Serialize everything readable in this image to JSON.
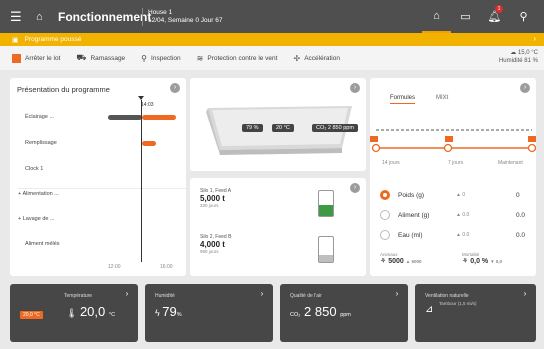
{
  "topbar": {
    "title": "Fonctionnement",
    "house_name": "House 1",
    "house_info": "12/04, Semaine 0 Jour 67",
    "alarm_count": "1"
  },
  "alert": {
    "text": "Programme poussé"
  },
  "actions": {
    "stop": "Arrêter le lot",
    "cleaning": "Ramassage",
    "inspection": "Inspection",
    "wind": "Protection contre le vent",
    "accel": "Accélération"
  },
  "weather": {
    "temp": "15,0 °C",
    "humidity": "Humidité 81 %"
  },
  "program": {
    "title": "Présentation du programme",
    "marker": "14:03",
    "rows": [
      "Éclairage ...",
      "Remplissage",
      "Clock 1",
      "Alimentation ...",
      "Lavage de ...",
      "Aliment mélés"
    ],
    "axis_start": "12:00",
    "axis_end": "16:00"
  },
  "house_view": {
    "badges": [
      "79 %",
      "20 °C",
      "CO₂ 2 850 ppm"
    ]
  },
  "silos": [
    {
      "name": "Silo 1, Feed A",
      "value": "5,000 t",
      "sub": "330 jours",
      "fill": 0.45
    },
    {
      "name": "Silo 2, Feed B",
      "value": "4,000 t",
      "sub": "990 jours",
      "fill": 0.3
    }
  ],
  "feeding": {
    "tabs": [
      "Formules",
      "MIXt"
    ],
    "steps": [
      "14 jours",
      "7 jours",
      "Maintenant"
    ],
    "rows": [
      {
        "label": "Poids (g)",
        "delta": "▲ 0",
        "value": "0",
        "selected": true
      },
      {
        "label": "Aliment (g)",
        "delta": "▲ 0.0",
        "value": "0.0",
        "selected": false
      },
      {
        "label": "Eau (ml)",
        "delta": "▲ 0.0",
        "value": "0.0",
        "selected": false
      }
    ],
    "bottom_left_label": "Animaux",
    "bottom_left_value": "5000",
    "bottom_left_delta": "▲ 5000",
    "bottom_right_label": "Mortalité",
    "bottom_right_value": "0,0 %",
    "bottom_right_delta": "▼ 0,0"
  },
  "tiles": [
    {
      "title": "Température",
      "value": "20,0",
      "unit": "°C",
      "tag": "20,0 °C"
    },
    {
      "title": "Humidité",
      "value": "79",
      "unit": "%"
    },
    {
      "title": "Qualité de l'air",
      "value": "2 850",
      "unit": "ppm",
      "prefix": "CO₂"
    },
    {
      "title": "Ventilation naturelle",
      "sub": "Tambour (1,5 mi/s)"
    }
  ]
}
